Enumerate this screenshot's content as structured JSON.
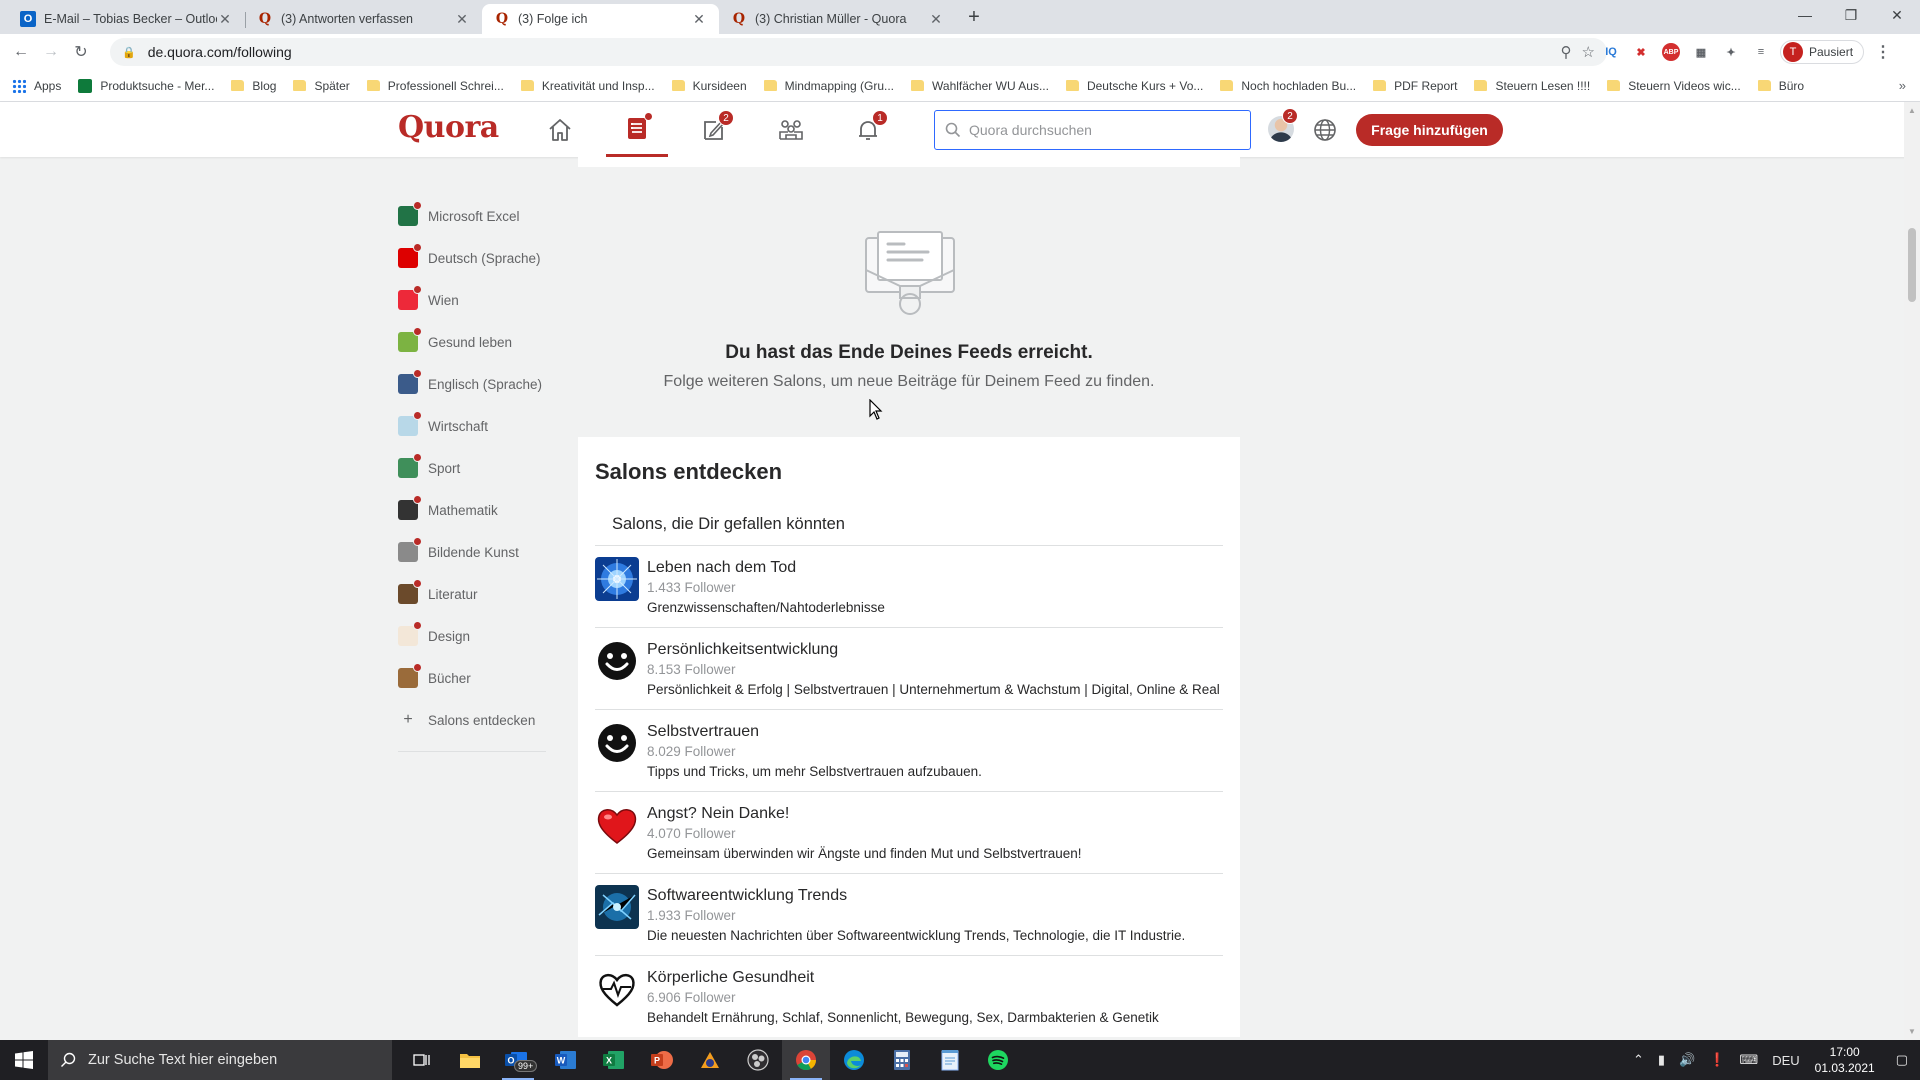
{
  "browser": {
    "tabs": [
      {
        "title": "E-Mail – Tobias Becker – Outlook",
        "favicon": "outlook",
        "active": false
      },
      {
        "title": "(3) Antworten verfassen",
        "favicon": "quora",
        "active": false
      },
      {
        "title": "(3) Folge ich",
        "favicon": "quora",
        "active": true
      },
      {
        "title": "(3) Christian Müller - Quora",
        "favicon": "quora",
        "active": false
      }
    ],
    "url": "de.quora.com/following",
    "profile_initial": "T",
    "profile_status": "Pausiert",
    "bookmarks": [
      {
        "label": "Apps",
        "type": "apps"
      },
      {
        "label": "Produktsuche - Mer...",
        "type": "site"
      },
      {
        "label": "Blog",
        "type": "folder"
      },
      {
        "label": "Später",
        "type": "folder"
      },
      {
        "label": "Professionell Schrei...",
        "type": "folder"
      },
      {
        "label": "Kreativität und Insp...",
        "type": "folder"
      },
      {
        "label": "Kursideen",
        "type": "folder"
      },
      {
        "label": "Mindmapping  (Gru...",
        "type": "folder"
      },
      {
        "label": "Wahlfächer WU Aus...",
        "type": "folder"
      },
      {
        "label": "Deutsche Kurs + Vo...",
        "type": "folder"
      },
      {
        "label": "Noch hochladen Bu...",
        "type": "folder"
      },
      {
        "label": "PDF Report",
        "type": "folder"
      },
      {
        "label": "Steuern Lesen !!!!",
        "type": "folder"
      },
      {
        "label": "Steuern Videos wic...",
        "type": "folder"
      },
      {
        "label": "Büro",
        "type": "folder"
      }
    ]
  },
  "quora": {
    "logo": "Quora",
    "nav_badges": {
      "answer": "2",
      "notifications": "1",
      "profile": "2"
    },
    "search_placeholder": "Quora durchsuchen",
    "add_question": "Frage hinzufügen",
    "brand_color": "#b92b27"
  },
  "sidebar": {
    "items": [
      {
        "label": "Microsoft Excel",
        "color": "#217346"
      },
      {
        "label": "Deutsch (Sprache)",
        "color": "#dd0000"
      },
      {
        "label": "Wien",
        "color": "#ed2939"
      },
      {
        "label": "Gesund leben",
        "color": "#7cb342"
      },
      {
        "label": "Englisch (Sprache)",
        "color": "#3b5b8a"
      },
      {
        "label": "Wirtschaft",
        "color": "#b8d8e8"
      },
      {
        "label": "Sport",
        "color": "#3f8f5a"
      },
      {
        "label": "Mathematik",
        "color": "#333333"
      },
      {
        "label": "Bildende Kunst",
        "color": "#8a8a8a"
      },
      {
        "label": "Literatur",
        "color": "#6b4a2b"
      },
      {
        "label": "Design",
        "color": "#f3e7d8"
      },
      {
        "label": "Bücher",
        "color": "#9a6b3a"
      }
    ],
    "add_label": "Salons entdecken"
  },
  "feed_end": {
    "title": "Du hast das Ende Deines Feeds erreicht.",
    "subtitle": "Folge weiteren Salons, um neue Beiträge für Deinem Feed zu finden."
  },
  "discover": {
    "title": "Salons entdecken",
    "subtitle": "Salons, die Dir gefallen könnten",
    "salons": [
      {
        "name": "Leben nach dem Tod",
        "followers": "1.433 Follower",
        "description": "Grenzwissenschaften/Nahtoderlebnisse",
        "icon": "burst"
      },
      {
        "name": "Persönlichkeitsentwicklung",
        "followers": "8.153 Follower",
        "description": "Persönlichkeit & Erfolg | Selbstvertrauen | Unternehmertum & Wachstum | Digital, Online & Real",
        "icon": "smiley"
      },
      {
        "name": "Selbstvertrauen",
        "followers": "8.029 Follower",
        "description": "Tipps und Tricks, um mehr Selbstvertrauen aufzubauen.",
        "icon": "smiley"
      },
      {
        "name": "Angst? Nein Danke!",
        "followers": "4.070 Follower",
        "description": "Gemeinsam überwinden wir Ängste und finden Mut und Selbstvertrauen!",
        "icon": "heart"
      },
      {
        "name": "Softwareentwicklung Trends",
        "followers": "1.933 Follower",
        "description": "Die neuesten Nachrichten über Softwareentwicklung Trends, Technologie, die IT Industrie.",
        "icon": "tech"
      },
      {
        "name": "Körperliche Gesundheit",
        "followers": "6.906 Follower",
        "description": "Behandelt Ernährung, Schlaf, Sonnenlicht, Bewegung, Sex, Darmbakterien & Genetik",
        "icon": "heartline"
      }
    ]
  },
  "taskbar": {
    "search_placeholder": "Zur Suche Text hier eingeben",
    "mail_badge": "99+",
    "language": "DEU",
    "time": "17:00",
    "date": "01.03.2021"
  }
}
